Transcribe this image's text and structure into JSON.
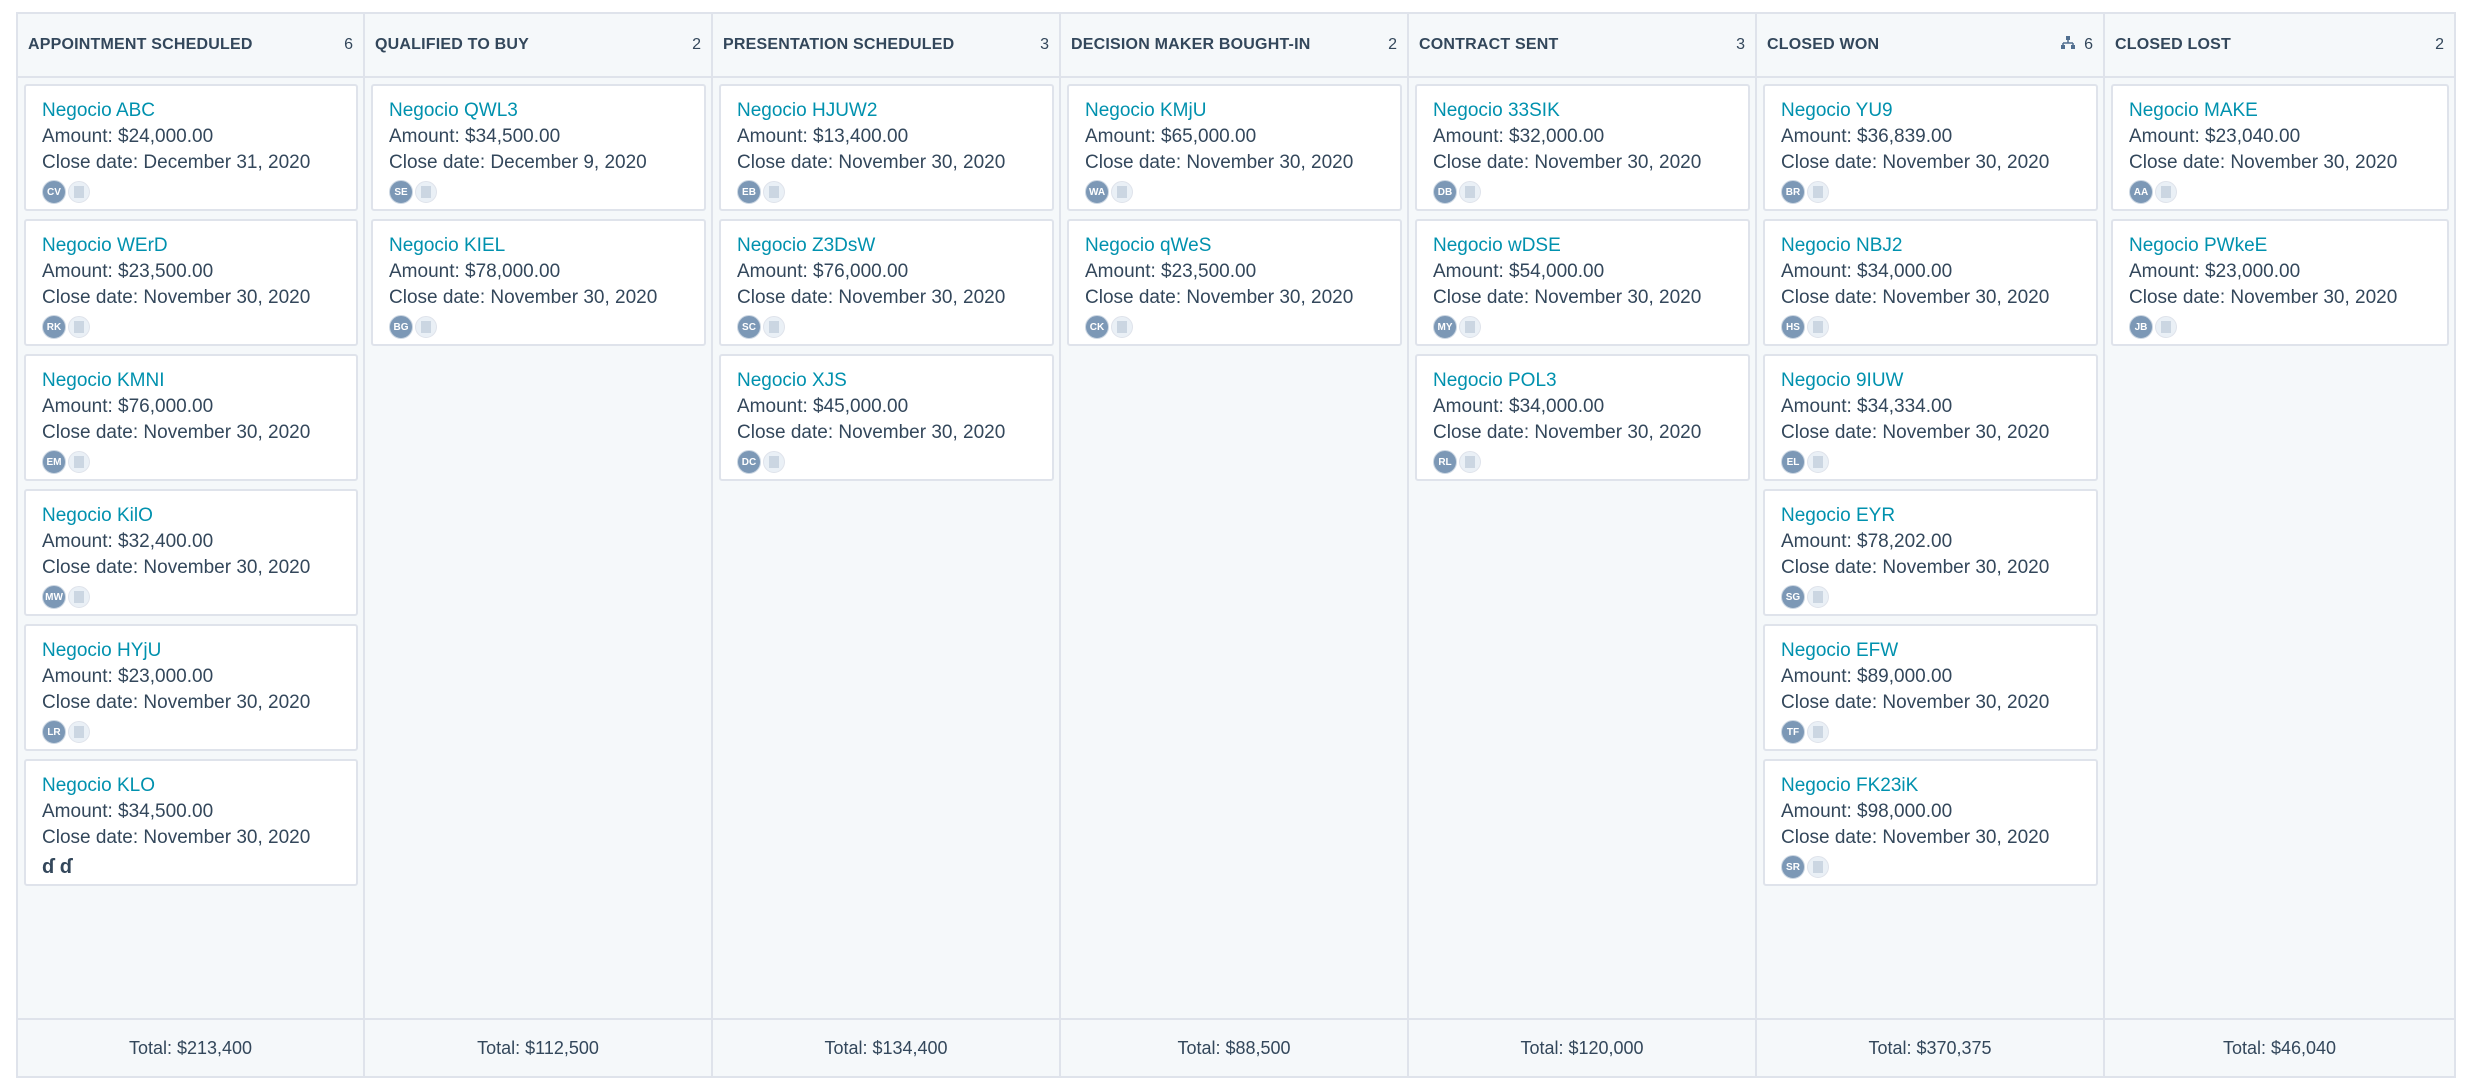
{
  "columns": [
    {
      "title": "APPOINTMENT SCHEDULED",
      "count": "6",
      "total": "Total: $213,400",
      "cards": [
        {
          "name": "Negocio ABC",
          "amount": "$24,000.00",
          "close": "December 31, 2020",
          "owner": "CV"
        },
        {
          "name": "Negocio WErD",
          "amount": "$23,500.00",
          "close": "November 30, 2020",
          "owner": "RK"
        },
        {
          "name": "Negocio KMNI",
          "amount": "$76,000.00",
          "close": "November 30, 2020",
          "owner": "EM"
        },
        {
          "name": "Negocio KilO",
          "amount": "$32,400.00",
          "close": "November 30, 2020",
          "owner": "MW"
        },
        {
          "name": "Negocio HYjU",
          "amount": "$23,000.00",
          "close": "November 30, 2020",
          "owner": "LR"
        },
        {
          "name": "Negocio KLO",
          "amount": "$34,500.00",
          "close": "November 30, 2020",
          "owner": "",
          "assoc": "ɗ ɗ"
        }
      ]
    },
    {
      "title": "QUALIFIED TO BUY",
      "count": "2",
      "total": "Total: $112,500",
      "cards": [
        {
          "name": "Negocio QWL3",
          "amount": "$34,500.00",
          "close": "December 9, 2020",
          "owner": "SE"
        },
        {
          "name": "Negocio KIEL",
          "amount": "$78,000.00",
          "close": "November 30, 2020",
          "owner": "BG"
        }
      ]
    },
    {
      "title": "PRESENTATION SCHEDULED",
      "count": "3",
      "total": "Total: $134,400",
      "cards": [
        {
          "name": "Negocio HJUW2",
          "amount": "$13,400.00",
          "close": "November 30, 2020",
          "owner": "EB"
        },
        {
          "name": "Negocio Z3DsW",
          "amount": "$76,000.00",
          "close": "November 30, 2020",
          "owner": "SC"
        },
        {
          "name": "Negocio XJS",
          "amount": "$45,000.00",
          "close": "November 30, 2020",
          "owner": "DC"
        }
      ]
    },
    {
      "title": "DECISION MAKER BOUGHT-IN",
      "count": "2",
      "total": "Total: $88,500",
      "cards": [
        {
          "name": "Negocio KMjU",
          "amount": "$65,000.00",
          "close": "November 30, 2020",
          "owner": "WA"
        },
        {
          "name": "Negocio qWeS",
          "amount": "$23,500.00",
          "close": "November 30, 2020",
          "owner": "CK"
        }
      ]
    },
    {
      "title": "CONTRACT SENT",
      "count": "3",
      "total": "Total: $120,000",
      "cards": [
        {
          "name": "Negocio 33SIK",
          "amount": "$32,000.00",
          "close": "November 30, 2020",
          "owner": "DB"
        },
        {
          "name": "Negocio wDSE",
          "amount": "$54,000.00",
          "close": "November 30, 2020",
          "owner": "MY"
        },
        {
          "name": "Negocio POL3",
          "amount": "$34,000.00",
          "close": "November 30, 2020",
          "owner": "RL"
        }
      ]
    },
    {
      "title": "CLOSED WON",
      "count": "6",
      "total": "Total: $370,375",
      "icon": "hierarchy-icon",
      "cards": [
        {
          "name": "Negocio YU9",
          "amount": "$36,839.00",
          "close": "November 30, 2020",
          "owner": "BR"
        },
        {
          "name": "Negocio NBJ2",
          "amount": "$34,000.00",
          "close": "November 30, 2020",
          "owner": "HS"
        },
        {
          "name": "Negocio 9IUW",
          "amount": "$34,334.00",
          "close": "November 30, 2020",
          "owner": "EL"
        },
        {
          "name": "Negocio EYR",
          "amount": "$78,202.00",
          "close": "November 30, 2020",
          "owner": "SG"
        },
        {
          "name": "Negocio EFW",
          "amount": "$89,000.00",
          "close": "November 30, 2020",
          "owner": "TF"
        },
        {
          "name": "Negocio FK23iK",
          "amount": "$98,000.00",
          "close": "November 30, 2020",
          "owner": "SR"
        }
      ]
    },
    {
      "title": "CLOSED LOST",
      "count": "2",
      "total": "Total: $46,040",
      "cards": [
        {
          "name": "Negocio MAKE",
          "amount": "$23,040.00",
          "close": "November 30, 2020",
          "owner": "AA"
        },
        {
          "name": "Negocio PWkeE",
          "amount": "$23,000.00",
          "close": "November 30, 2020",
          "owner": "JB"
        }
      ]
    }
  ],
  "labels": {
    "amount": "Amount:",
    "close_date": "Close date:"
  },
  "colors": {
    "link": "#0091ae",
    "text": "#33475b",
    "border": "#dfe3eb",
    "background": "#f5f8fa",
    "avatar": "#7c98b6"
  }
}
